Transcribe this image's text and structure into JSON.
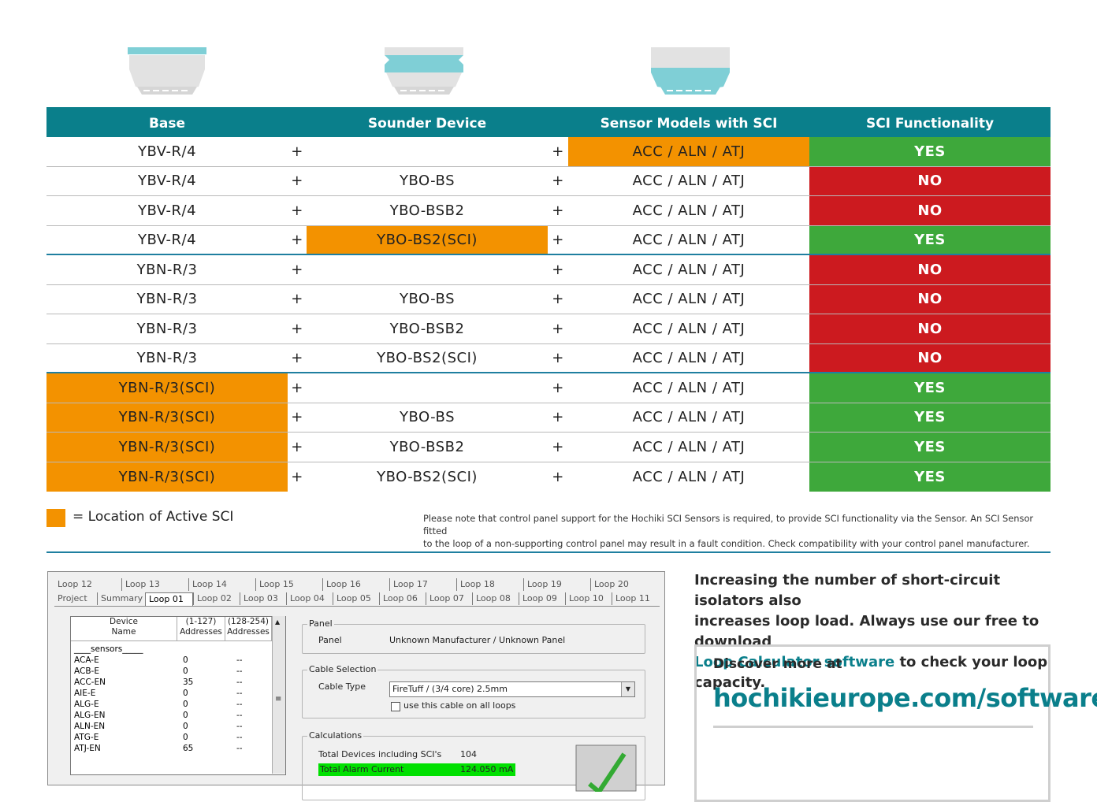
{
  "table": {
    "headers": {
      "base": "Base",
      "sounder": "Sounder Device",
      "sensor": "Sensor Models with SCI",
      "sci": "SCI Functionality"
    },
    "rows": [
      {
        "base": "YBV-R/4",
        "plus1": "+",
        "sounder": "",
        "plus2": "+",
        "sensor": "ACC / ALN / ATJ",
        "sci": "YES",
        "highlight": "sensor"
      },
      {
        "base": "YBV-R/4",
        "plus1": "+",
        "sounder": "YBO-BS",
        "plus2": "+",
        "sensor": "ACC / ALN / ATJ",
        "sci": "NO",
        "highlight": ""
      },
      {
        "base": "YBV-R/4",
        "plus1": "+",
        "sounder": "YBO-BSB2",
        "plus2": "+",
        "sensor": "ACC / ALN / ATJ",
        "sci": "NO",
        "highlight": ""
      },
      {
        "base": "YBV-R/4",
        "plus1": "+",
        "sounder": "YBO-BS2(SCI)",
        "plus2": "+",
        "sensor": "ACC / ALN / ATJ",
        "sci": "YES",
        "highlight": "sounder"
      },
      {
        "base": "YBN-R/3",
        "plus1": "+",
        "sounder": "",
        "plus2": "+",
        "sensor": "ACC / ALN / ATJ",
        "sci": "NO",
        "highlight": ""
      },
      {
        "base": "YBN-R/3",
        "plus1": "+",
        "sounder": "YBO-BS",
        "plus2": "+",
        "sensor": "ACC / ALN / ATJ",
        "sci": "NO",
        "highlight": ""
      },
      {
        "base": "YBN-R/3",
        "plus1": "+",
        "sounder": "YBO-BSB2",
        "plus2": "+",
        "sensor": "ACC / ALN / ATJ",
        "sci": "NO",
        "highlight": ""
      },
      {
        "base": "YBN-R/3",
        "plus1": "+",
        "sounder": "YBO-BS2(SCI)",
        "plus2": "+",
        "sensor": "ACC / ALN / ATJ",
        "sci": "NO",
        "highlight": ""
      },
      {
        "base": "YBN-R/3(SCI)",
        "plus1": "+",
        "sounder": "",
        "plus2": "+",
        "sensor": "ACC / ALN / ATJ",
        "sci": "YES",
        "highlight": "base"
      },
      {
        "base": "YBN-R/3(SCI)",
        "plus1": "+",
        "sounder": "YBO-BS",
        "plus2": "+",
        "sensor": "ACC / ALN / ATJ",
        "sci": "YES",
        "highlight": "base"
      },
      {
        "base": "YBN-R/3(SCI)",
        "plus1": "+",
        "sounder": "YBO-BSB2",
        "plus2": "+",
        "sensor": "ACC / ALN / ATJ",
        "sci": "YES",
        "highlight": "base"
      },
      {
        "base": "YBN-R/3(SCI)",
        "plus1": "+",
        "sounder": "YBO-BS2(SCI)",
        "plus2": "+",
        "sensor": "ACC / ALN / ATJ",
        "sci": "YES",
        "highlight": "base"
      }
    ]
  },
  "colors": {
    "header_teal": "#0a7f8b",
    "sci_orange": "#f39200",
    "yes_green": "#3ea83b",
    "no_red": "#cc1a1f"
  },
  "legend": {
    "text": "= Location of Active SCI"
  },
  "note": {
    "line1": "Please note that control panel support for the Hochiki SCI Sensors is required, to provide SCI functionality via the Sensor. An SCI Sensor fitted",
    "line2": "to the loop of a non-supporting control panel may result in a fault condition.  Check compatibility with your control panel manufacturer."
  },
  "software": {
    "tabs_top": [
      "Loop 12",
      "Loop 13",
      "Loop 14",
      "Loop 15",
      "Loop 16",
      "Loop 17",
      "Loop 18",
      "Loop 19",
      "Loop 20"
    ],
    "tabs_bottom": [
      "Project",
      "Summary",
      "Loop 01",
      "Loop 02",
      "Loop 03",
      "Loop 04",
      "Loop 05",
      "Loop 06",
      "Loop 07",
      "Loop 08",
      "Loop 09",
      "Loop 10",
      "Loop 11"
    ],
    "list_headers": {
      "name": "Device\nName",
      "addr1": "(1-127)\nAddresses",
      "addr2": "(128-254)\nAddresses"
    },
    "list_group": "____sensors_____",
    "list_rows": [
      {
        "name": "ACA-E",
        "a1": "0",
        "a2": "--"
      },
      {
        "name": "ACB-E",
        "a1": "0",
        "a2": "--"
      },
      {
        "name": "ACC-EN",
        "a1": "35",
        "a2": "--"
      },
      {
        "name": "AIE-E",
        "a1": "0",
        "a2": "--"
      },
      {
        "name": "ALG-E",
        "a1": "0",
        "a2": "--"
      },
      {
        "name": "ALG-EN",
        "a1": "0",
        "a2": "--"
      },
      {
        "name": "ALN-EN",
        "a1": "0",
        "a2": "--"
      },
      {
        "name": "ATG-E",
        "a1": "0",
        "a2": "--"
      },
      {
        "name": "ATJ-EN",
        "a1": "65",
        "a2": "--"
      }
    ],
    "panel_group": "Panel",
    "panel_label": "Panel",
    "panel_value": "Unknown Manufacturer / Unknown Panel",
    "cable_group": "Cable Selection",
    "cable_label": "Cable Type",
    "cable_value": "FireTuff / (3/4 core) 2.5mm",
    "cable_checkbox": "use this cable on all loops",
    "calc_group": "Calculations",
    "total_devices_label": "Total Devices including SCI's",
    "total_devices_value": "104",
    "alarm_label": "Total Alarm Current",
    "alarm_value": "124.050 mA"
  },
  "promo": {
    "line1": "Increasing the number of short-circuit isolators also",
    "line2": "increases loop load. Always use our free to download",
    "link": "Loop Calculator software",
    "line3_rest": " to check your loop capacity."
  },
  "discover": {
    "title": "Discover more at",
    "url": "hochikieurope.com/software"
  }
}
